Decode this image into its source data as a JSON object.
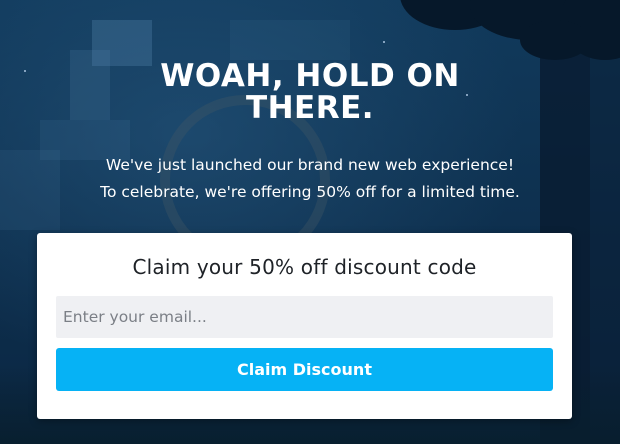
{
  "hero": {
    "title": "WOAH, HOLD ON THERE.",
    "subtitle_line1": "We've just launched our brand new web experience!",
    "subtitle_line2": "To celebrate, we're offering 50% off for a limited time."
  },
  "form": {
    "heading": "Claim your 50% off discount code",
    "email_placeholder": "Enter your email...",
    "email_value": "",
    "submit_label": "Claim Discount"
  },
  "colors": {
    "background": "#0e3150",
    "card": "#ffffff",
    "input_bg": "#eff0f3",
    "accent": "#06b2f5",
    "text_dark": "#1e2227",
    "text_light": "#ffffff"
  }
}
